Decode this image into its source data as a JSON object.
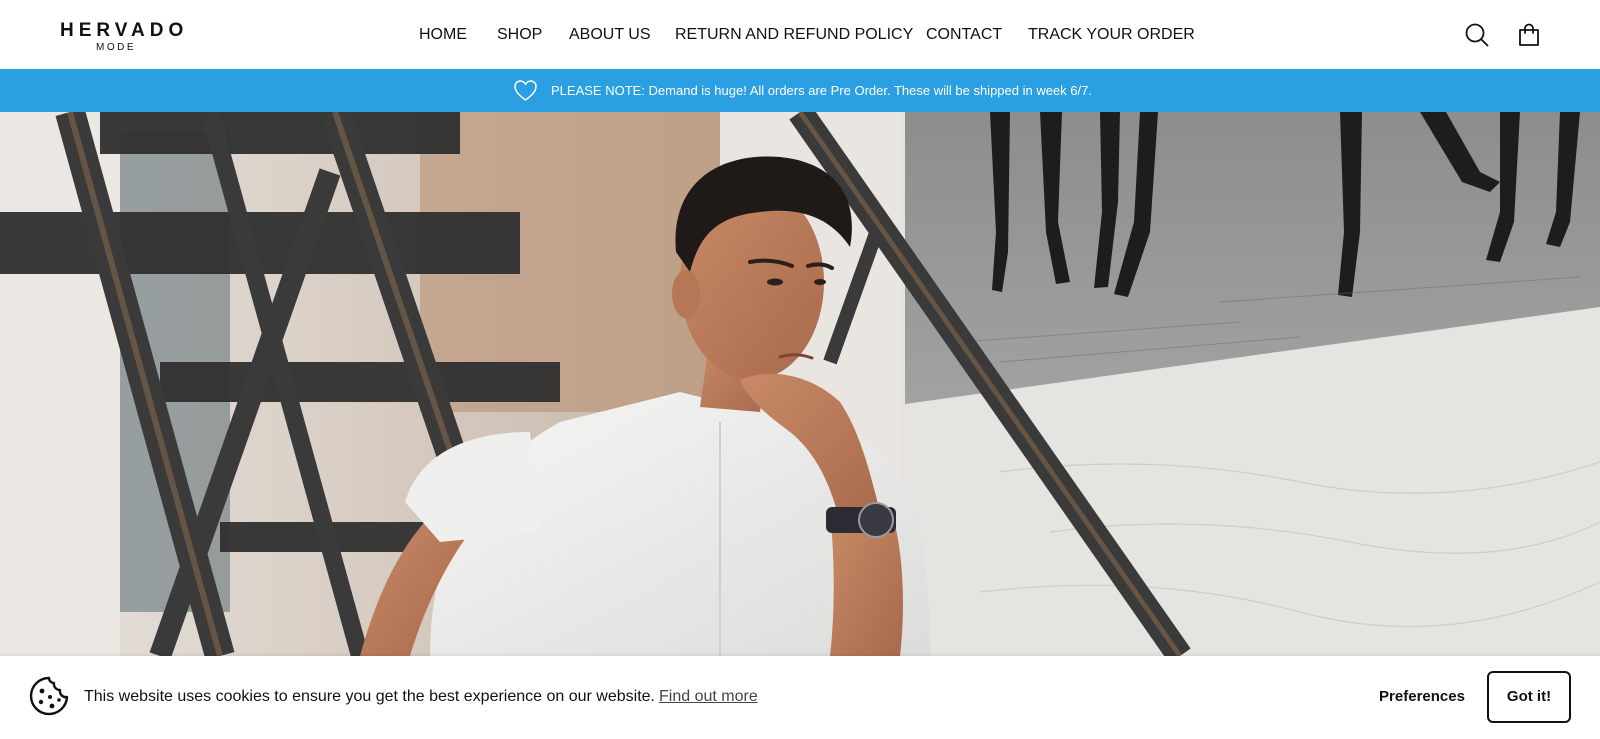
{
  "brand": {
    "name": "HERVADO",
    "sub": "MODE"
  },
  "nav": {
    "items": [
      {
        "label": "HOME"
      },
      {
        "label": "SHOP"
      },
      {
        "label": "ABOUT US"
      },
      {
        "label": "RETURN AND REFUND POLICY"
      },
      {
        "label": "CONTACT"
      },
      {
        "label": "TRACK YOUR ORDER"
      }
    ]
  },
  "header_icons": {
    "search": "search-icon",
    "cart": "shopping-bag-icon"
  },
  "announcement": {
    "text": "PLEASE NOTE: Demand is huge! All orders are Pre Order. These will be shipped in week 6/7.",
    "icon": "heart-icon",
    "background": "#2a9fe1"
  },
  "cookie": {
    "message": "This website uses cookies to ensure you get the best experience on our website.",
    "link": "Find out more",
    "preferences": "Preferences",
    "accept": "Got it!",
    "icon": "cookie-icon"
  }
}
